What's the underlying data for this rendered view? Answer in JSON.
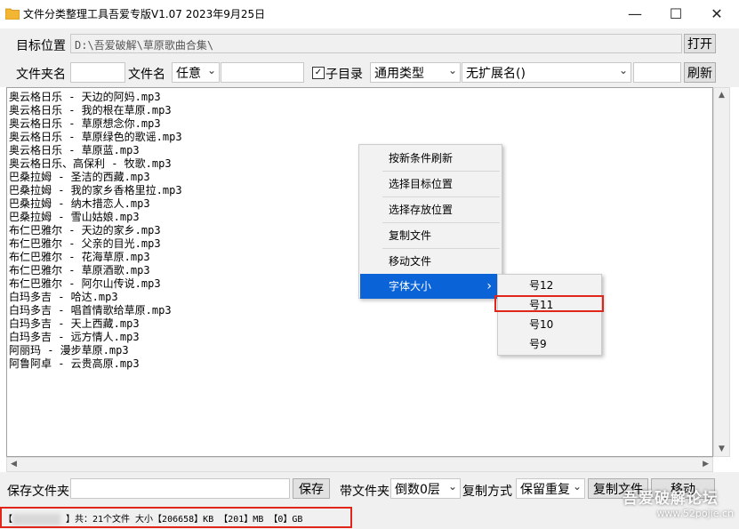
{
  "window": {
    "title": "文件分类整理工具吾爱专版V1.07  2023年9月25日",
    "minimize": "—",
    "maximize": "☐",
    "close": "✕"
  },
  "toolbar": {
    "target_label": "目标位置",
    "target_path": "D:\\吾爱破解\\草原歌曲合集\\",
    "open_button": "打开",
    "folder_name_label": "文件夹名",
    "folder_name_value": "",
    "file_name_label": "文件名",
    "file_name_mode": "任意",
    "file_name_value": "",
    "subdir_checkbox": "子目录",
    "subdir_checked": true,
    "file_type": "通用类型",
    "extension": "无扩展名()",
    "extra_value": "",
    "refresh_button": "刷新"
  },
  "files": [
    "奥云格日乐 - 天边的阿妈.mp3",
    "奥云格日乐 - 我的根在草原.mp3",
    "奥云格日乐 - 草原想念你.mp3",
    "奥云格日乐 - 草原绿色的歌谣.mp3",
    "奥云格日乐 - 草原蓝.mp3",
    "奥云格日乐、高保利 - 牧歌.mp3",
    "巴桑拉姆 - 圣洁的西藏.mp3",
    "巴桑拉姆 - 我的家乡香格里拉.mp3",
    "巴桑拉姆 - 纳木措恋人.mp3",
    "巴桑拉姆 - 雪山姑娘.mp3",
    "布仁巴雅尔 - 天边的家乡.mp3",
    "布仁巴雅尔 - 父亲的目光.mp3",
    "布仁巴雅尔 - 花海草原.mp3",
    "布仁巴雅尔 - 草原酒歌.mp3",
    "布仁巴雅尔 - 阿尔山传说.mp3",
    "白玛多吉 - 哈达.mp3",
    "白玛多吉 - 唱首情歌给草原.mp3",
    "白玛多吉 - 天上西藏.mp3",
    "白玛多吉 - 远方情人.mp3",
    "阿丽玛 - 漫步草原.mp3",
    "阿鲁阿卓 - 云贵高原.mp3"
  ],
  "context_menu": {
    "items": [
      "按新条件刷新",
      "选择目标位置",
      "选择存放位置",
      "复制文件",
      "移动文件",
      "字体大小"
    ],
    "submenu_arrow": "›",
    "font_sizes": [
      "号12",
      "号11",
      "号10",
      "号9"
    ]
  },
  "bottom": {
    "save_folder_label": "保存文件夹",
    "save_folder_value": "",
    "save_button": "保存",
    "with_folder_label": "带文件夹",
    "level": "倒数0层",
    "copy_mode_label": "复制方式",
    "copy_mode": "保留重复",
    "copy_button": "复制文件",
    "move_button": "移动"
  },
  "status": {
    "text": "】共：21个文件  大小【206658】KB 【201】MB  【0】GB"
  },
  "watermark": {
    "line1": "吾爱破解论坛",
    "line2": "www.52pojie.cn"
  },
  "colors": {
    "accent": "#0a64d8",
    "highlight_box": "#e0261b"
  }
}
